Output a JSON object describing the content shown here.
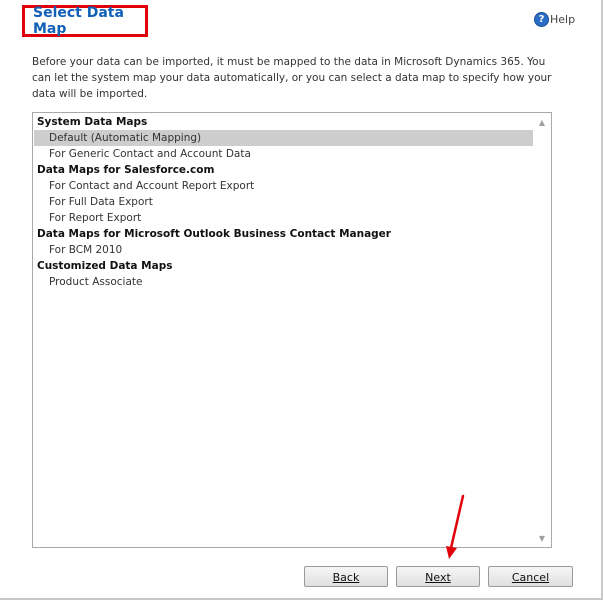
{
  "dialog": {
    "title": "Select Data Map",
    "help_label": "Help",
    "intro_text": "Before your data can be imported, it must be mapped to the data in Microsoft Dynamics 365. You can let the system map your data automatically, or you can select a data map to specify how your data will be imported."
  },
  "list": {
    "groups": [
      {
        "label": "System Data Maps",
        "items": [
          "Default (Automatic Mapping)",
          "For Generic Contact and Account Data"
        ]
      },
      {
        "label": "Data Maps for Salesforce.com",
        "items": [
          "For Contact and Account Report Export",
          "For Full Data Export",
          "For Report Export"
        ]
      },
      {
        "label": "Data Maps for Microsoft Outlook Business Contact Manager",
        "items": [
          "For BCM 2010"
        ]
      },
      {
        "label": "Customized Data Maps",
        "items": [
          "Product Associate"
        ]
      }
    ],
    "selected_item": "Default (Automatic Mapping)"
  },
  "buttons": {
    "back": "Back",
    "next": "Next",
    "cancel": "Cancel"
  },
  "icons": {
    "help": "help-icon",
    "scroll_up": "scroll-up-arrow-icon",
    "scroll_down": "scroll-down-arrow-icon",
    "annotation": "red-arrow-icon"
  },
  "colors": {
    "title": "#1160b7",
    "highlight_border": "#e0000a",
    "selected_row": "#cdcdcd",
    "annotation_arrow": "#e0000a"
  }
}
